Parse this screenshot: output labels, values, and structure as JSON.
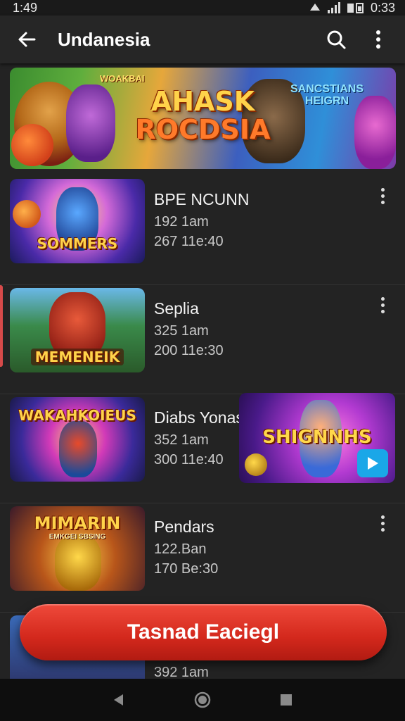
{
  "status_bar": {
    "time": "1:49",
    "right_time": "0:33"
  },
  "app_bar": {
    "title": "Undanesia"
  },
  "banner": {
    "title_line1": "AHASK",
    "title_line2": "ROCDSIA",
    "badge_left": "WOAKBAI",
    "badge_right_line1": "SANCSTIANS",
    "badge_right_line2": "HEIGRN"
  },
  "items": [
    {
      "title": "BPE NCUNN",
      "meta1": "192 1am",
      "meta2": "267 11e:40",
      "thumb_text": "SOMMERS",
      "thumb_sub": ""
    },
    {
      "title": "Seplia",
      "meta1": "325 1am",
      "meta2": "200 11e:30",
      "thumb_text": "MEMENEIK",
      "thumb_sub": ""
    },
    {
      "title": "Diabs Yonas",
      "meta1": "352 1am",
      "meta2": "300 11e:40",
      "thumb_text": "WAKAHKOIEUS",
      "thumb_sub": ""
    },
    {
      "title": "Pendars",
      "meta1": "122.Ban",
      "meta2": "170 Be:30",
      "thumb_text": "MIMARIN",
      "thumb_sub": "EMKGEI SBSING"
    },
    {
      "title": "",
      "meta1": "392 1am",
      "meta2": "",
      "thumb_text": "",
      "thumb_sub": ""
    }
  ],
  "promo": {
    "text": "SHIGNNHS"
  },
  "cta": {
    "label": "Tasnad Eaciegl"
  },
  "colors": {
    "cta": "#d3281c",
    "background": "#232323",
    "app_bar": "#262626"
  }
}
